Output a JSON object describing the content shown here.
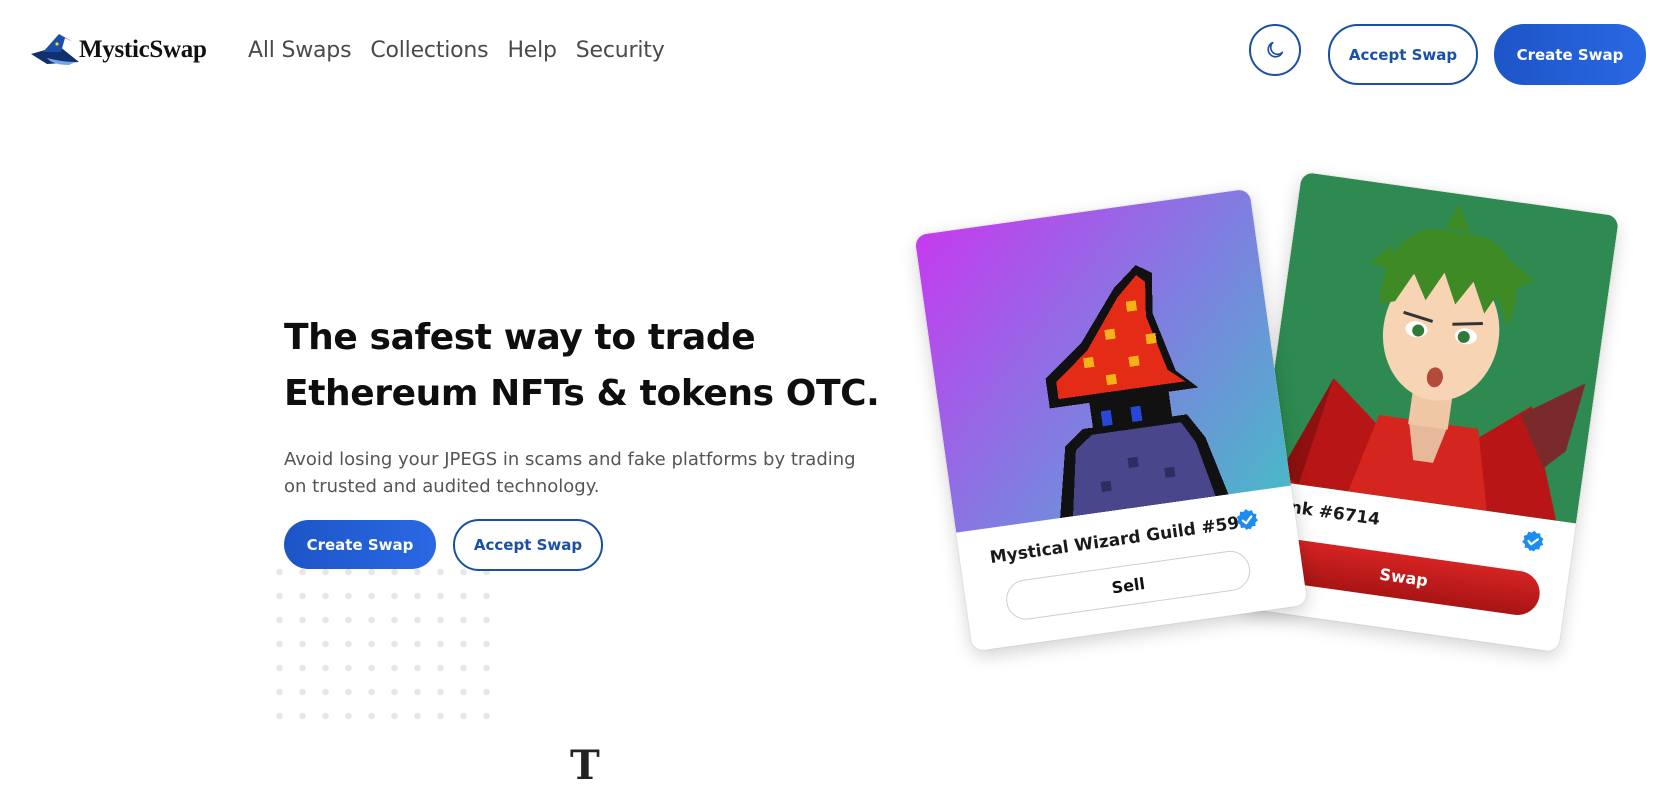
{
  "header": {
    "logo_text": "MysticSwap",
    "nav": [
      "All Swaps",
      "Collections",
      "Help",
      "Security"
    ],
    "accept_swap": "Accept Swap",
    "create_swap": "Create Swap"
  },
  "hero": {
    "title_line1": "The safest way to trade",
    "title_line2": "Ethereum NFTs & tokens OTC.",
    "subtitle_line1": "Avoid losing your JPEGS in scams and fake platforms by trading",
    "subtitle_line2": "on trusted and audited technology.",
    "create_swap": "Create Swap",
    "accept_swap": "Accept Swap"
  },
  "cards": {
    "wizard": {
      "title": "Mystical Wizard Guild #59",
      "button": "Sell"
    },
    "junk": {
      "title": "Junk #6714",
      "button": "Swap"
    }
  },
  "colors": {
    "brand_blue": "#1a4fa8",
    "swap_red": "#c81d1d",
    "verified_blue": "#1d8cf0"
  },
  "icons": {
    "theme_toggle": "moon-icon",
    "verified": "verified-badge-icon"
  }
}
